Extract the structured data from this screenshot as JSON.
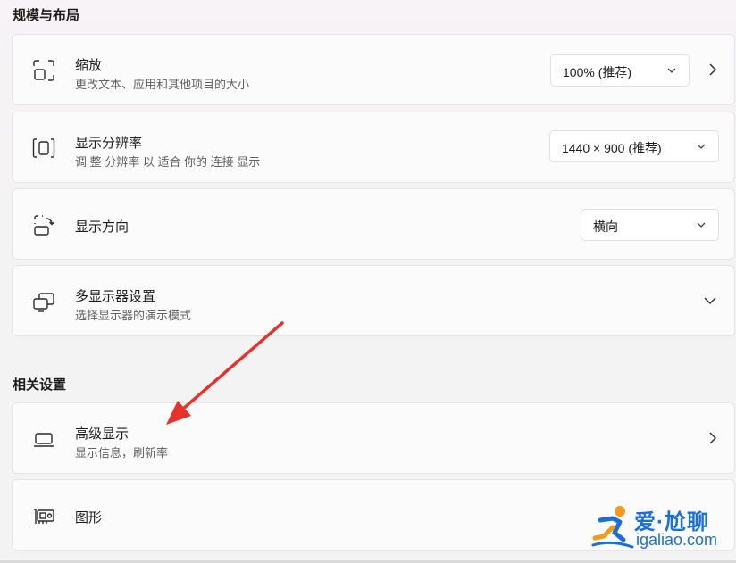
{
  "sections": {
    "scale_layout": "规模与布局",
    "related": "相关设置"
  },
  "scale": {
    "title": "缩放",
    "subtitle": "更改文本、应用和其他项目的大小",
    "value": "100% (推荐)",
    "icon": "scale-icon"
  },
  "resolution": {
    "title": "显示分辨率",
    "subtitle": "调 整 分辨率 以 适合 你的 连接 显示",
    "value": "1440 × 900 (推荐)",
    "icon": "resolution-icon"
  },
  "orientation": {
    "title": "显示方向",
    "value": "横向",
    "icon": "orientation-icon"
  },
  "multi_display": {
    "title": "多显示器设置",
    "subtitle": "选择显示器的演示模式",
    "icon": "multi-display-icon"
  },
  "advanced_display": {
    "title": "高级显示",
    "subtitle": "显示信息，刷新率",
    "icon": "laptop-icon"
  },
  "graphics": {
    "title": "图形",
    "icon": "graphics-card-icon"
  },
  "watermark": {
    "brand": "爱·尬聊",
    "url": "igaliao.com"
  },
  "colors": {
    "annotation_arrow": "#e8312a",
    "watermark_blue": "#1a6fd6",
    "watermark_orange": "#f39a1e"
  }
}
